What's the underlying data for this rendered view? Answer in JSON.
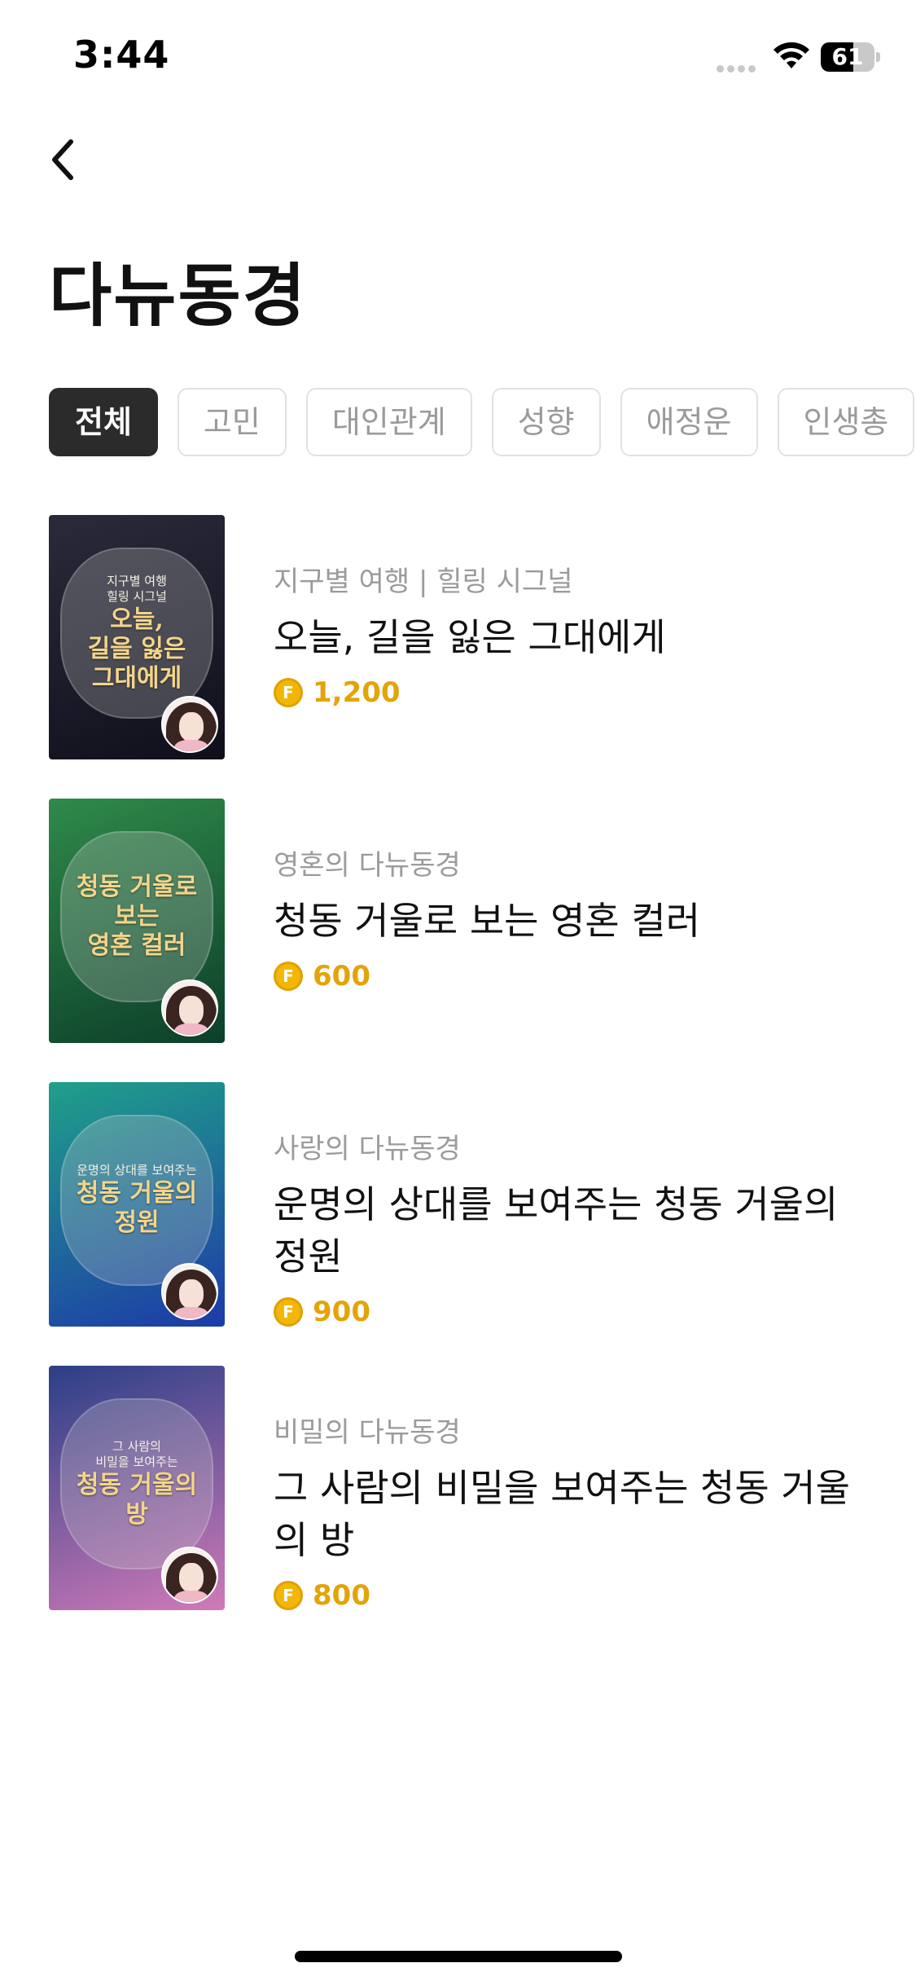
{
  "status_bar": {
    "time": "3:44",
    "battery_level": "61",
    "battery_fraction": 0.61
  },
  "header": {
    "back_icon": "chevron-left-icon",
    "title": "다뉴동경"
  },
  "tabs": [
    {
      "label": "전체",
      "active": true
    },
    {
      "label": "고민",
      "active": false
    },
    {
      "label": "대인관계",
      "active": false
    },
    {
      "label": "성향",
      "active": false
    },
    {
      "label": "애정운",
      "active": false
    },
    {
      "label": "인생총",
      "active": false
    }
  ],
  "items": [
    {
      "category": "지구별 여행 | 힐링 시그널",
      "title": "오늘, 길을 잃은 그대에게",
      "price": "1,200",
      "thumb_small": "지구별 여행\n힐링 시그널",
      "thumb_big": "오늘,\n길을 잃은\n그대에게",
      "thumb_colors": [
        "#2a2a3a",
        "#0f0f1c"
      ]
    },
    {
      "category": "영혼의 다뉴동경",
      "title": "청동 거울로 보는 영혼 컬러",
      "price": "600",
      "thumb_small": "",
      "thumb_big": "청동 거울로 보는\n영혼 컬러",
      "thumb_colors": [
        "#2f8a4a",
        "#0c3f2a"
      ]
    },
    {
      "category": "사랑의 다뉴동경",
      "title": "운명의 상대를 보여주는 청동 거울의 정원",
      "price": "900",
      "thumb_small": "운명의 상대를 보여주는",
      "thumb_big": "청동 거울의\n정원",
      "thumb_colors": [
        "#1fa08a",
        "#1d3aa8"
      ]
    },
    {
      "category": "비밀의 다뉴동경",
      "title": "그 사람의 비밀을 보여주는 청동 거울의 방",
      "price": "800",
      "thumb_small": "그 사람의\n비밀을 보여주는",
      "thumb_big": "청동 거울의 방",
      "thumb_colors": [
        "#2b3f86",
        "#d07ab8"
      ]
    }
  ],
  "coin_symbol": "F",
  "colors": {
    "accent_price": "#e3a40a",
    "active_tab_bg": "#2b2b2b"
  }
}
